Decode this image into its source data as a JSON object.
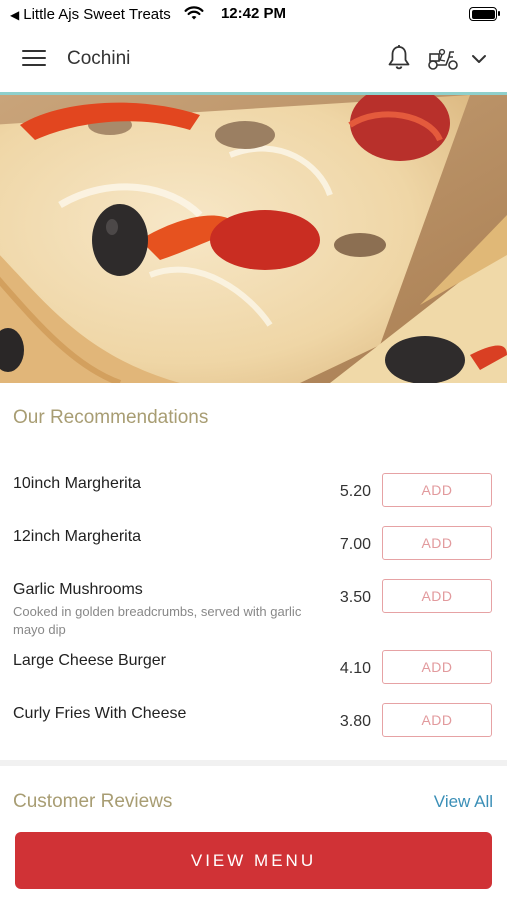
{
  "status_bar": {
    "back_app": "Little Ajs Sweet Treats",
    "time": "12:42 PM"
  },
  "header": {
    "title": "Cochini",
    "icons": [
      "menu-icon",
      "bell-icon",
      "delivery-scooter-icon",
      "chevron-down-icon"
    ]
  },
  "hero": {
    "image": "pizza-photo"
  },
  "recommendations": {
    "title": "Our Recommendations",
    "items": [
      {
        "name": "10inch Margherita",
        "description": "",
        "price": "5.20",
        "button": "ADD"
      },
      {
        "name": "12inch Margherita",
        "description": "",
        "price": "7.00",
        "button": "ADD"
      },
      {
        "name": "Garlic Mushrooms",
        "description": "Cooked in golden breadcrumbs, served with garlic mayo dip",
        "price": "3.50",
        "button": "ADD"
      },
      {
        "name": "Large Cheese Burger",
        "description": "",
        "price": "4.10",
        "button": "ADD"
      },
      {
        "name": "Curly Fries With Cheese",
        "description": "",
        "price": "3.80",
        "button": "ADD"
      }
    ]
  },
  "reviews": {
    "title": "Customer Reviews",
    "view_all": "View All"
  },
  "footer": {
    "cta": "VIEW MENU"
  },
  "colors": {
    "accent_red": "#d03236",
    "section_title": "#a89d73",
    "link_blue": "#3b8fb7",
    "header_border": "#8fd0cc"
  }
}
